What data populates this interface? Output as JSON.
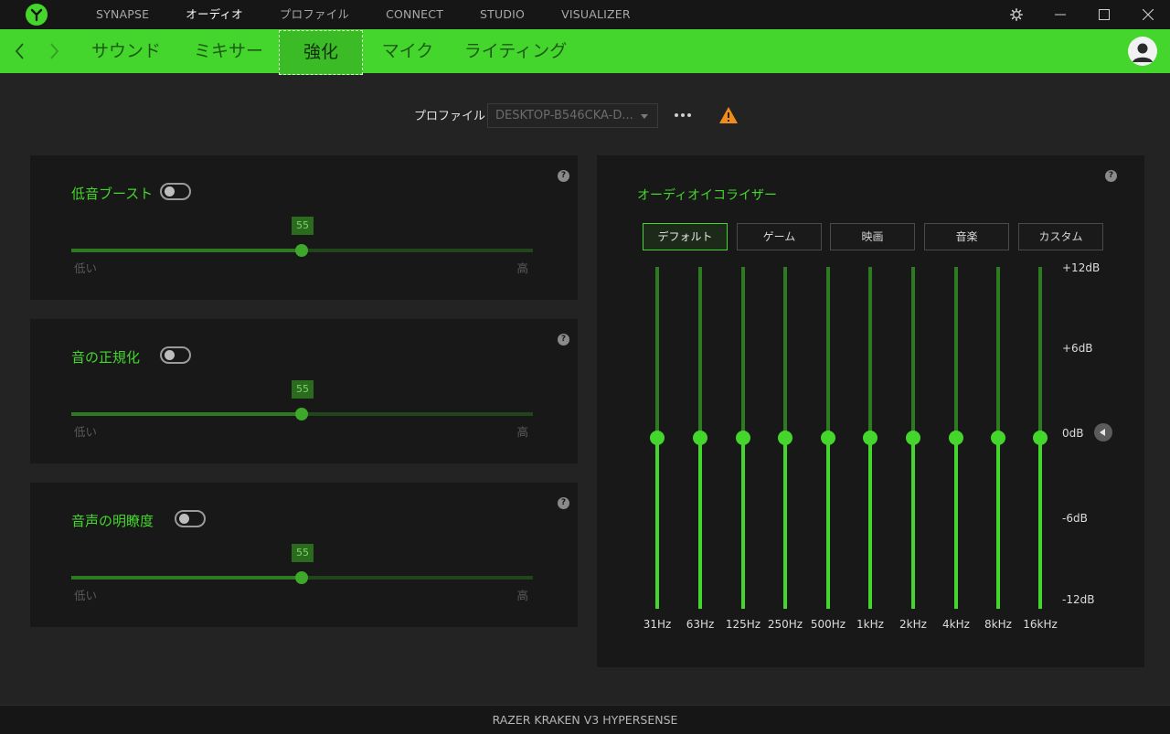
{
  "titlebar": {
    "tabs": [
      "SYNAPSE",
      "オーディオ",
      "プロファイル",
      "CONNECT",
      "STUDIO",
      "VISUALIZER"
    ],
    "active_tab": "オーディオ"
  },
  "subnav": {
    "tabs": [
      "サウンド",
      "ミキサー",
      "強化",
      "マイク",
      "ライティング"
    ],
    "active_tab": "強化"
  },
  "profile": {
    "label": "プロファイル",
    "selected": "DESKTOP-B546CKA-D..."
  },
  "panels": {
    "bass_boost": {
      "title": "低音ブースト",
      "enabled": false,
      "value": "55",
      "low": "低い",
      "high": "高"
    },
    "normalization": {
      "title": "音の正規化",
      "enabled": false,
      "value": "55",
      "low": "低い",
      "high": "高"
    },
    "voice_clarity": {
      "title": "音声の明瞭度",
      "enabled": false,
      "value": "55",
      "low": "低い",
      "high": "高"
    }
  },
  "equalizer": {
    "title": "オーディオイコライザー",
    "presets": [
      "デフォルト",
      "ゲーム",
      "映画",
      "音楽",
      "カスタム"
    ],
    "active_preset": "デフォルト",
    "bands": [
      {
        "freq": "31Hz",
        "gain_db": 0
      },
      {
        "freq": "63Hz",
        "gain_db": 0
      },
      {
        "freq": "125Hz",
        "gain_db": 0
      },
      {
        "freq": "250Hz",
        "gain_db": 0
      },
      {
        "freq": "500Hz",
        "gain_db": 0
      },
      {
        "freq": "1kHz",
        "gain_db": 0
      },
      {
        "freq": "2kHz",
        "gain_db": 0
      },
      {
        "freq": "4kHz",
        "gain_db": 0
      },
      {
        "freq": "8kHz",
        "gain_db": 0
      },
      {
        "freq": "16kHz",
        "gain_db": 0
      }
    ],
    "db_labels": [
      "+12dB",
      "+6dB",
      "0dB",
      "-6dB",
      "-12dB"
    ]
  },
  "footer": {
    "device": "RAZER KRAKEN V3 HYPERSENSE"
  },
  "colors": {
    "accent": "#44d62c",
    "background": "#232323",
    "panel": "#181818",
    "warning": "#f08c1c"
  }
}
